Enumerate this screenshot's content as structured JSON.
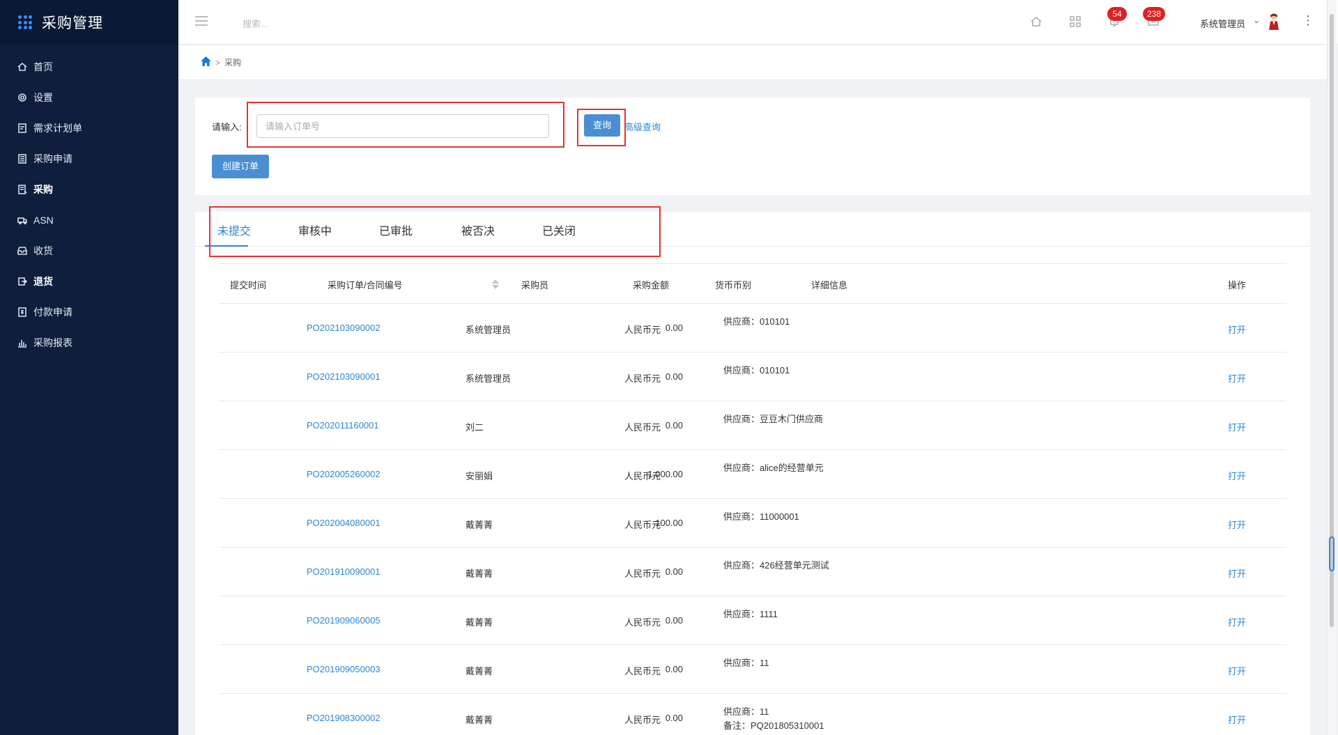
{
  "app": {
    "title": "采购管理"
  },
  "sidebar": {
    "items": [
      {
        "label": "首页",
        "icon": "home-icon"
      },
      {
        "label": "设置",
        "icon": "gear-icon"
      },
      {
        "label": "需求计划单",
        "icon": "document-icon"
      },
      {
        "label": "采购申请",
        "icon": "form-icon"
      },
      {
        "label": "采购",
        "icon": "purchase-icon",
        "active": true
      },
      {
        "label": "ASN",
        "icon": "truck-icon"
      },
      {
        "label": "收货",
        "icon": "inbox-icon"
      },
      {
        "label": "退货",
        "icon": "return-icon",
        "active": true
      },
      {
        "label": "付款申请",
        "icon": "payment-icon"
      },
      {
        "label": "采购报表",
        "icon": "bar-chart-icon"
      }
    ]
  },
  "header": {
    "search_placeholder": "搜索...",
    "notifications_count": "54",
    "messages_count": "238",
    "user_name": "系统管理员"
  },
  "breadcrumb": {
    "current": "采购",
    "separator": ">"
  },
  "search": {
    "label": "请输入:",
    "placeholder": "请输入订单号",
    "query_button": "查询",
    "advanced_link": "高级查询",
    "create_button": "创建订单"
  },
  "tabs": [
    {
      "label": "未提交",
      "active": true
    },
    {
      "label": "审核中"
    },
    {
      "label": "已审批"
    },
    {
      "label": "被否决"
    },
    {
      "label": "已关闭"
    }
  ],
  "table": {
    "columns": [
      "提交时间",
      "采购订单/合同编号",
      "采购员",
      "采购金额",
      "货币币别",
      "详细信息",
      "操作"
    ],
    "rows": [
      {
        "submit_time": "",
        "po": "PO202103090002",
        "buyer": "系统管理员",
        "amount": "0.00",
        "currency": "人民币元",
        "detail": "供应商：010101",
        "detail2": "",
        "action": "打开"
      },
      {
        "submit_time": "",
        "po": "PO202103090001",
        "buyer": "系统管理员",
        "amount": "0.00",
        "currency": "人民币元",
        "detail": "供应商：010101",
        "detail2": "",
        "action": "打开"
      },
      {
        "submit_time": "",
        "po": "PO202011160001",
        "buyer": "刘二",
        "amount": "0.00",
        "currency": "人民币元",
        "detail": "供应商：豆豆木门供应商",
        "detail2": "",
        "action": "打开"
      },
      {
        "submit_time": "",
        "po": "PO202005260002",
        "buyer": "安丽娟",
        "amount": "1,000.00",
        "currency": "人民币元",
        "detail": "供应商：alice的经营单元",
        "detail2": "",
        "action": "打开"
      },
      {
        "submit_time": "",
        "po": "PO202004080001",
        "buyer": "戴菁菁",
        "amount": "100.00",
        "currency": "人民币元",
        "detail": "供应商：11000001",
        "detail2": "",
        "action": "打开"
      },
      {
        "submit_time": "",
        "po": "PO201910090001",
        "buyer": "戴菁菁",
        "amount": "0.00",
        "currency": "人民币元",
        "detail": "供应商：426经营单元测试",
        "detail2": "",
        "action": "打开"
      },
      {
        "submit_time": "",
        "po": "PO201909060005",
        "buyer": "戴菁菁",
        "amount": "0.00",
        "currency": "人民币元",
        "detail": "供应商：1111",
        "detail2": "",
        "action": "打开"
      },
      {
        "submit_time": "",
        "po": "PO201909050003",
        "buyer": "戴菁菁",
        "amount": "0.00",
        "currency": "人民币元",
        "detail": "供应商：11",
        "detail2": "",
        "action": "打开"
      },
      {
        "submit_time": "",
        "po": "PO201908300002",
        "buyer": "戴菁菁",
        "amount": "0.00",
        "currency": "人民币元",
        "detail": "供应商：11",
        "detail2": "备注：PQ201805310001",
        "action": "打开"
      }
    ]
  },
  "colors": {
    "sidebar_bg": "#0d1f3d",
    "accent": "#2b86d8",
    "button": "#4a8fd3",
    "highlight_border": "#e8312f",
    "badge": "#e02020"
  }
}
